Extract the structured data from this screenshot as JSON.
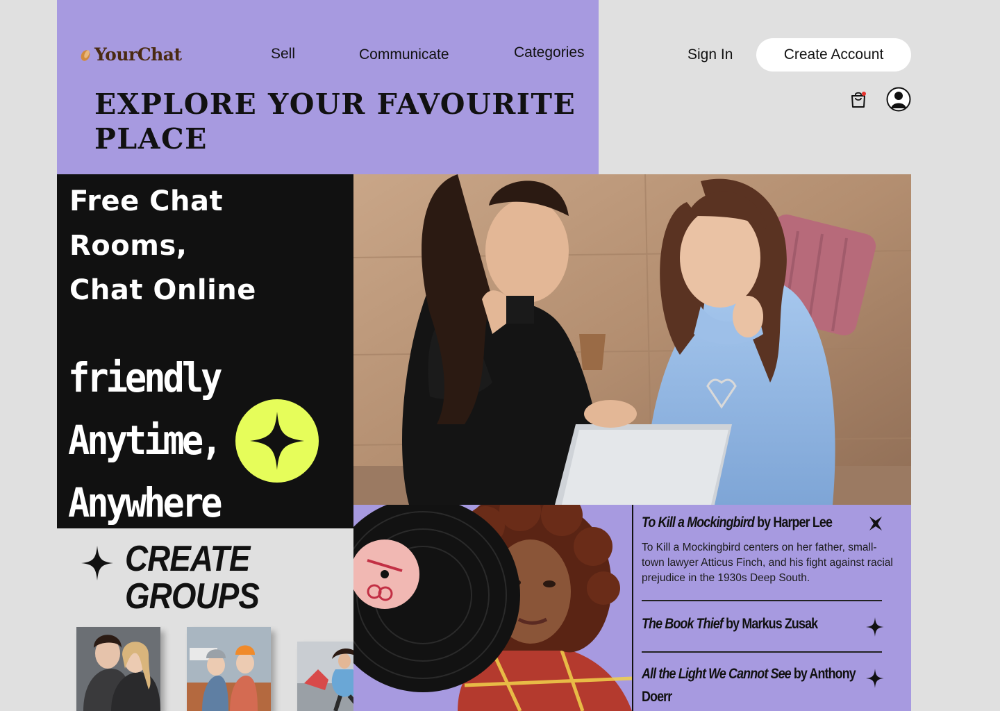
{
  "brand": {
    "name": "YourChat"
  },
  "nav": {
    "sell": "Sell",
    "communicate": "Communicate",
    "categories": "Categories"
  },
  "auth": {
    "sign_in": "Sign In",
    "create_account": "Create Account"
  },
  "icons": [
    "cart-icon",
    "profile-icon",
    "sparkle-icon",
    "pinwheel-icon"
  ],
  "hero": {
    "title": "EXPLORE YOUR FAVOURITE PLACE",
    "chat_title_line1": "Free Chat",
    "chat_title_line2": "Rooms,",
    "chat_title_line3": "Chat Online",
    "tagline1": "friendly",
    "tagline2": "Anytime,",
    "tagline3": "Anywhere"
  },
  "groups": {
    "heading_line1": "CREATE",
    "heading_line2": "GROUPS"
  },
  "books": [
    {
      "title": "To Kill a Mockingbird",
      "by": " by Harper Lee",
      "description": "To Kill a Mockingbird centers on her father, small-town lawyer Atticus Finch, and his fight against racial prejudice in the 1930s Deep South."
    },
    {
      "title": "The Book Thief",
      "by": " by Markus Zusak"
    },
    {
      "title": "All the Light We Cannot See",
      "by": " by Anthony",
      "by_line2": "Doerr"
    }
  ],
  "colors": {
    "accent_purple": "#a79ae0",
    "lime": "#e6fd5a",
    "dark": "#111111",
    "page_bg": "#e0e0e0"
  }
}
